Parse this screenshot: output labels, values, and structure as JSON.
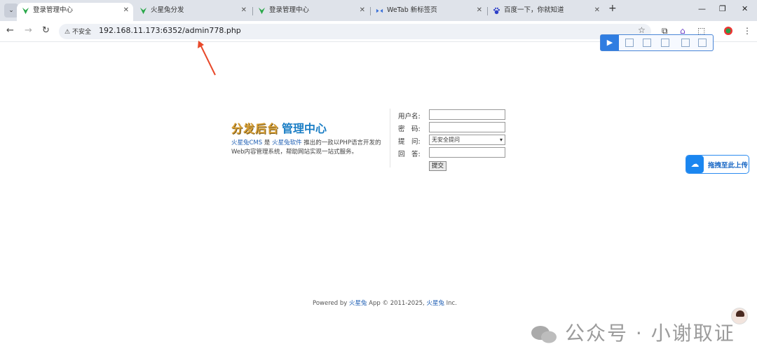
{
  "browser": {
    "tabs": [
      {
        "title": "登录管理中心",
        "active": true,
        "icon": "huoxingtu-leaf-icon"
      },
      {
        "title": "火星兔分发",
        "active": false,
        "icon": "huoxingtu-leaf-icon"
      },
      {
        "title": "登录管理中心",
        "active": false,
        "icon": "huoxingtu-leaf-icon"
      },
      {
        "title": "WeTab 新标签页",
        "active": false,
        "icon": "wetab-icon"
      },
      {
        "title": "百度一下，你就知道",
        "active": false,
        "icon": "baidu-paw-icon"
      }
    ],
    "security_label": "不安全",
    "url": "192.168.11.173:6352/admin778.php"
  },
  "login": {
    "title_part1": "分发后台",
    "title_part2": "管理中心",
    "intro_brand": "火星兔CMS",
    "intro_is": " 是 ",
    "intro_company": "火星兔软件",
    "intro_rest": " 推出的一款以PHP语言开发的Web内容管理系统，帮助网站实现一站式服务。",
    "username_label": "用户名:",
    "password_label": "密　码:",
    "question_label": "提　问:",
    "question_selected": "无安全提问",
    "answer_label": "回　答:",
    "submit_label": "提交"
  },
  "upload_widget": {
    "label": "拖拽至此上传"
  },
  "footer": {
    "prefix": "Powered by ",
    "brand": "火星兔",
    "middle": " App © 2011-2025, ",
    "brand2": "火星兔",
    "suffix": " Inc."
  },
  "watermark": {
    "text": "公众号 · 小谢取证"
  },
  "colors": {
    "accent_blue": "#1b7ec5",
    "logo_gold": "#d8a036",
    "arrow_red": "#e8492a"
  }
}
